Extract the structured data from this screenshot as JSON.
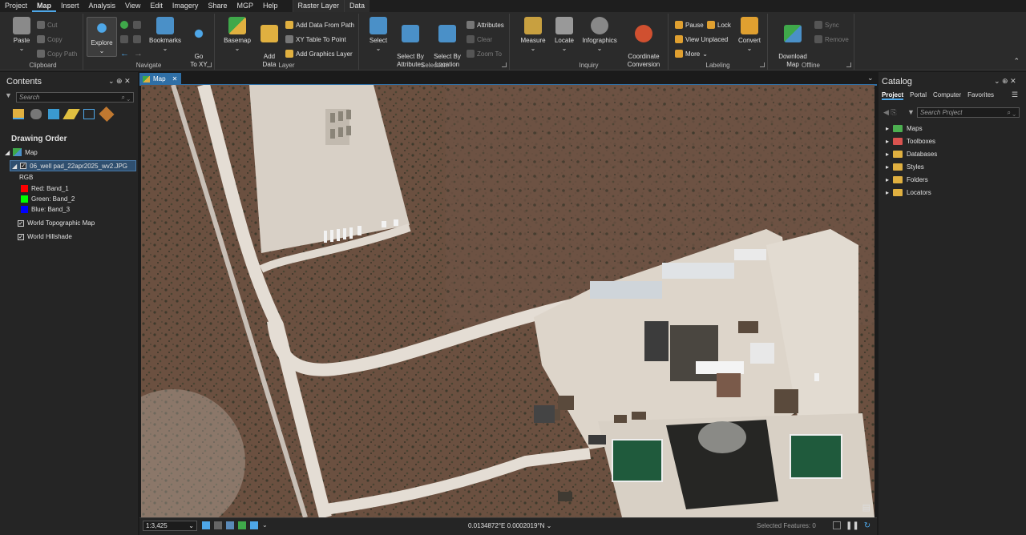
{
  "menu": {
    "items": [
      "Project",
      "Map",
      "Insert",
      "Analysis",
      "View",
      "Edit",
      "Imagery",
      "Share",
      "MGP",
      "Help"
    ],
    "active": "Map",
    "contextual": [
      "Raster Layer",
      "Data"
    ]
  },
  "ribbon": {
    "clipboard": {
      "label": "Clipboard",
      "paste": "Paste",
      "cut": "Cut",
      "copy": "Copy",
      "copy_path": "Copy Path"
    },
    "navigate": {
      "label": "Navigate",
      "explore": "Explore",
      "bookmarks": "Bookmarks",
      "go_to_xy": "Go\nTo XY"
    },
    "layer": {
      "label": "Layer",
      "basemap": "Basemap",
      "add_data": "Add\nData",
      "add_from_path": "Add Data From Path",
      "xy_table": "XY Table To Point",
      "add_graphics": "Add Graphics Layer"
    },
    "selection": {
      "label": "Selection",
      "select": "Select",
      "by_attr": "Select By\nAttributes",
      "by_loc": "Select By\nLocation",
      "attributes": "Attributes",
      "clear": "Clear",
      "zoom_to": "Zoom To"
    },
    "inquiry": {
      "label": "Inquiry",
      "measure": "Measure",
      "locate": "Locate",
      "infographics": "Infographics",
      "coord_conv": "Coordinate\nConversion"
    },
    "labeling": {
      "label": "Labeling",
      "pause": "Pause",
      "lock": "Lock",
      "view_unplaced": "View Unplaced",
      "more": "More",
      "convert": "Convert"
    },
    "offline": {
      "label": "Offline",
      "download_map": "Download\nMap",
      "sync": "Sync",
      "remove": "Remove"
    }
  },
  "contents": {
    "title": "Contents",
    "search_placeholder": "Search",
    "drawing_order": "Drawing Order",
    "map_name": "Map",
    "layer_name": "06_well pad_22apr2025_wv2.JPG",
    "rgb": "RGB",
    "bands": [
      {
        "label": "Red:  Band_1",
        "color": "#ff0000"
      },
      {
        "label": "Green: Band_2",
        "color": "#00ff00"
      },
      {
        "label": "Blue:  Band_3",
        "color": "#0000ff"
      }
    ],
    "basemaps": [
      "World Topographic Map",
      "World Hillshade"
    ]
  },
  "map_tab": {
    "label": "Map"
  },
  "status": {
    "scale": "1:3,425",
    "coords": "0.0134872°E 0.0002019°N",
    "selected": "Selected Features: 0"
  },
  "catalog": {
    "title": "Catalog",
    "tabs": [
      "Project",
      "Portal",
      "Computer",
      "Favorites"
    ],
    "active_tab": "Project",
    "search_placeholder": "Search Project",
    "items": [
      {
        "label": "Maps",
        "color": "#4caf50"
      },
      {
        "label": "Toolboxes",
        "color": "#d9534f"
      },
      {
        "label": "Databases",
        "color": "#e0b040"
      },
      {
        "label": "Styles",
        "color": "#e0b040"
      },
      {
        "label": "Folders",
        "color": "#e0b040"
      },
      {
        "label": "Locators",
        "color": "#e0b040"
      }
    ]
  }
}
